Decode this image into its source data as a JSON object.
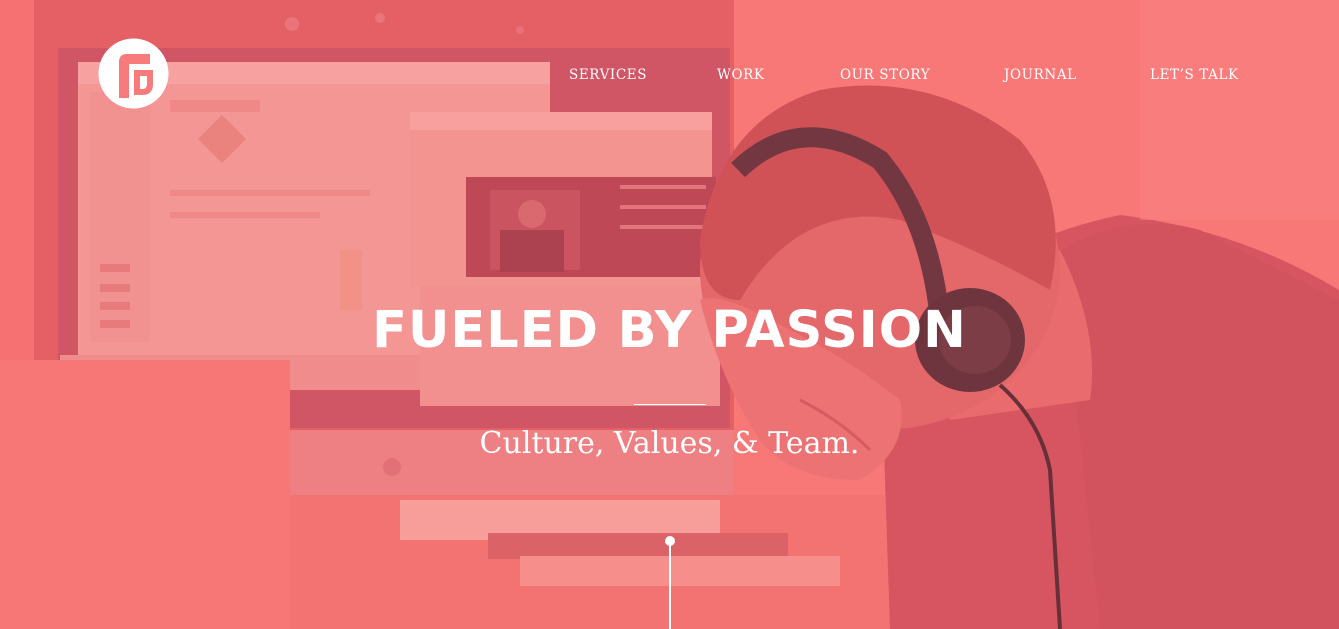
{
  "brand": {
    "logo_icon": "fueled-logo-icon",
    "overlay_color": "#f87b7b"
  },
  "nav": {
    "items": [
      {
        "label": "SERVICES"
      },
      {
        "label": "WORK"
      },
      {
        "label": "OUR STORY"
      },
      {
        "label": "JOURNAL"
      },
      {
        "label": "LET’S TALK"
      }
    ]
  },
  "hero": {
    "headline": "FUELED BY PASSION",
    "subtitle": "Culture, Values, & Team.",
    "scroll_indicator_icon": "scroll-down-indicator"
  }
}
